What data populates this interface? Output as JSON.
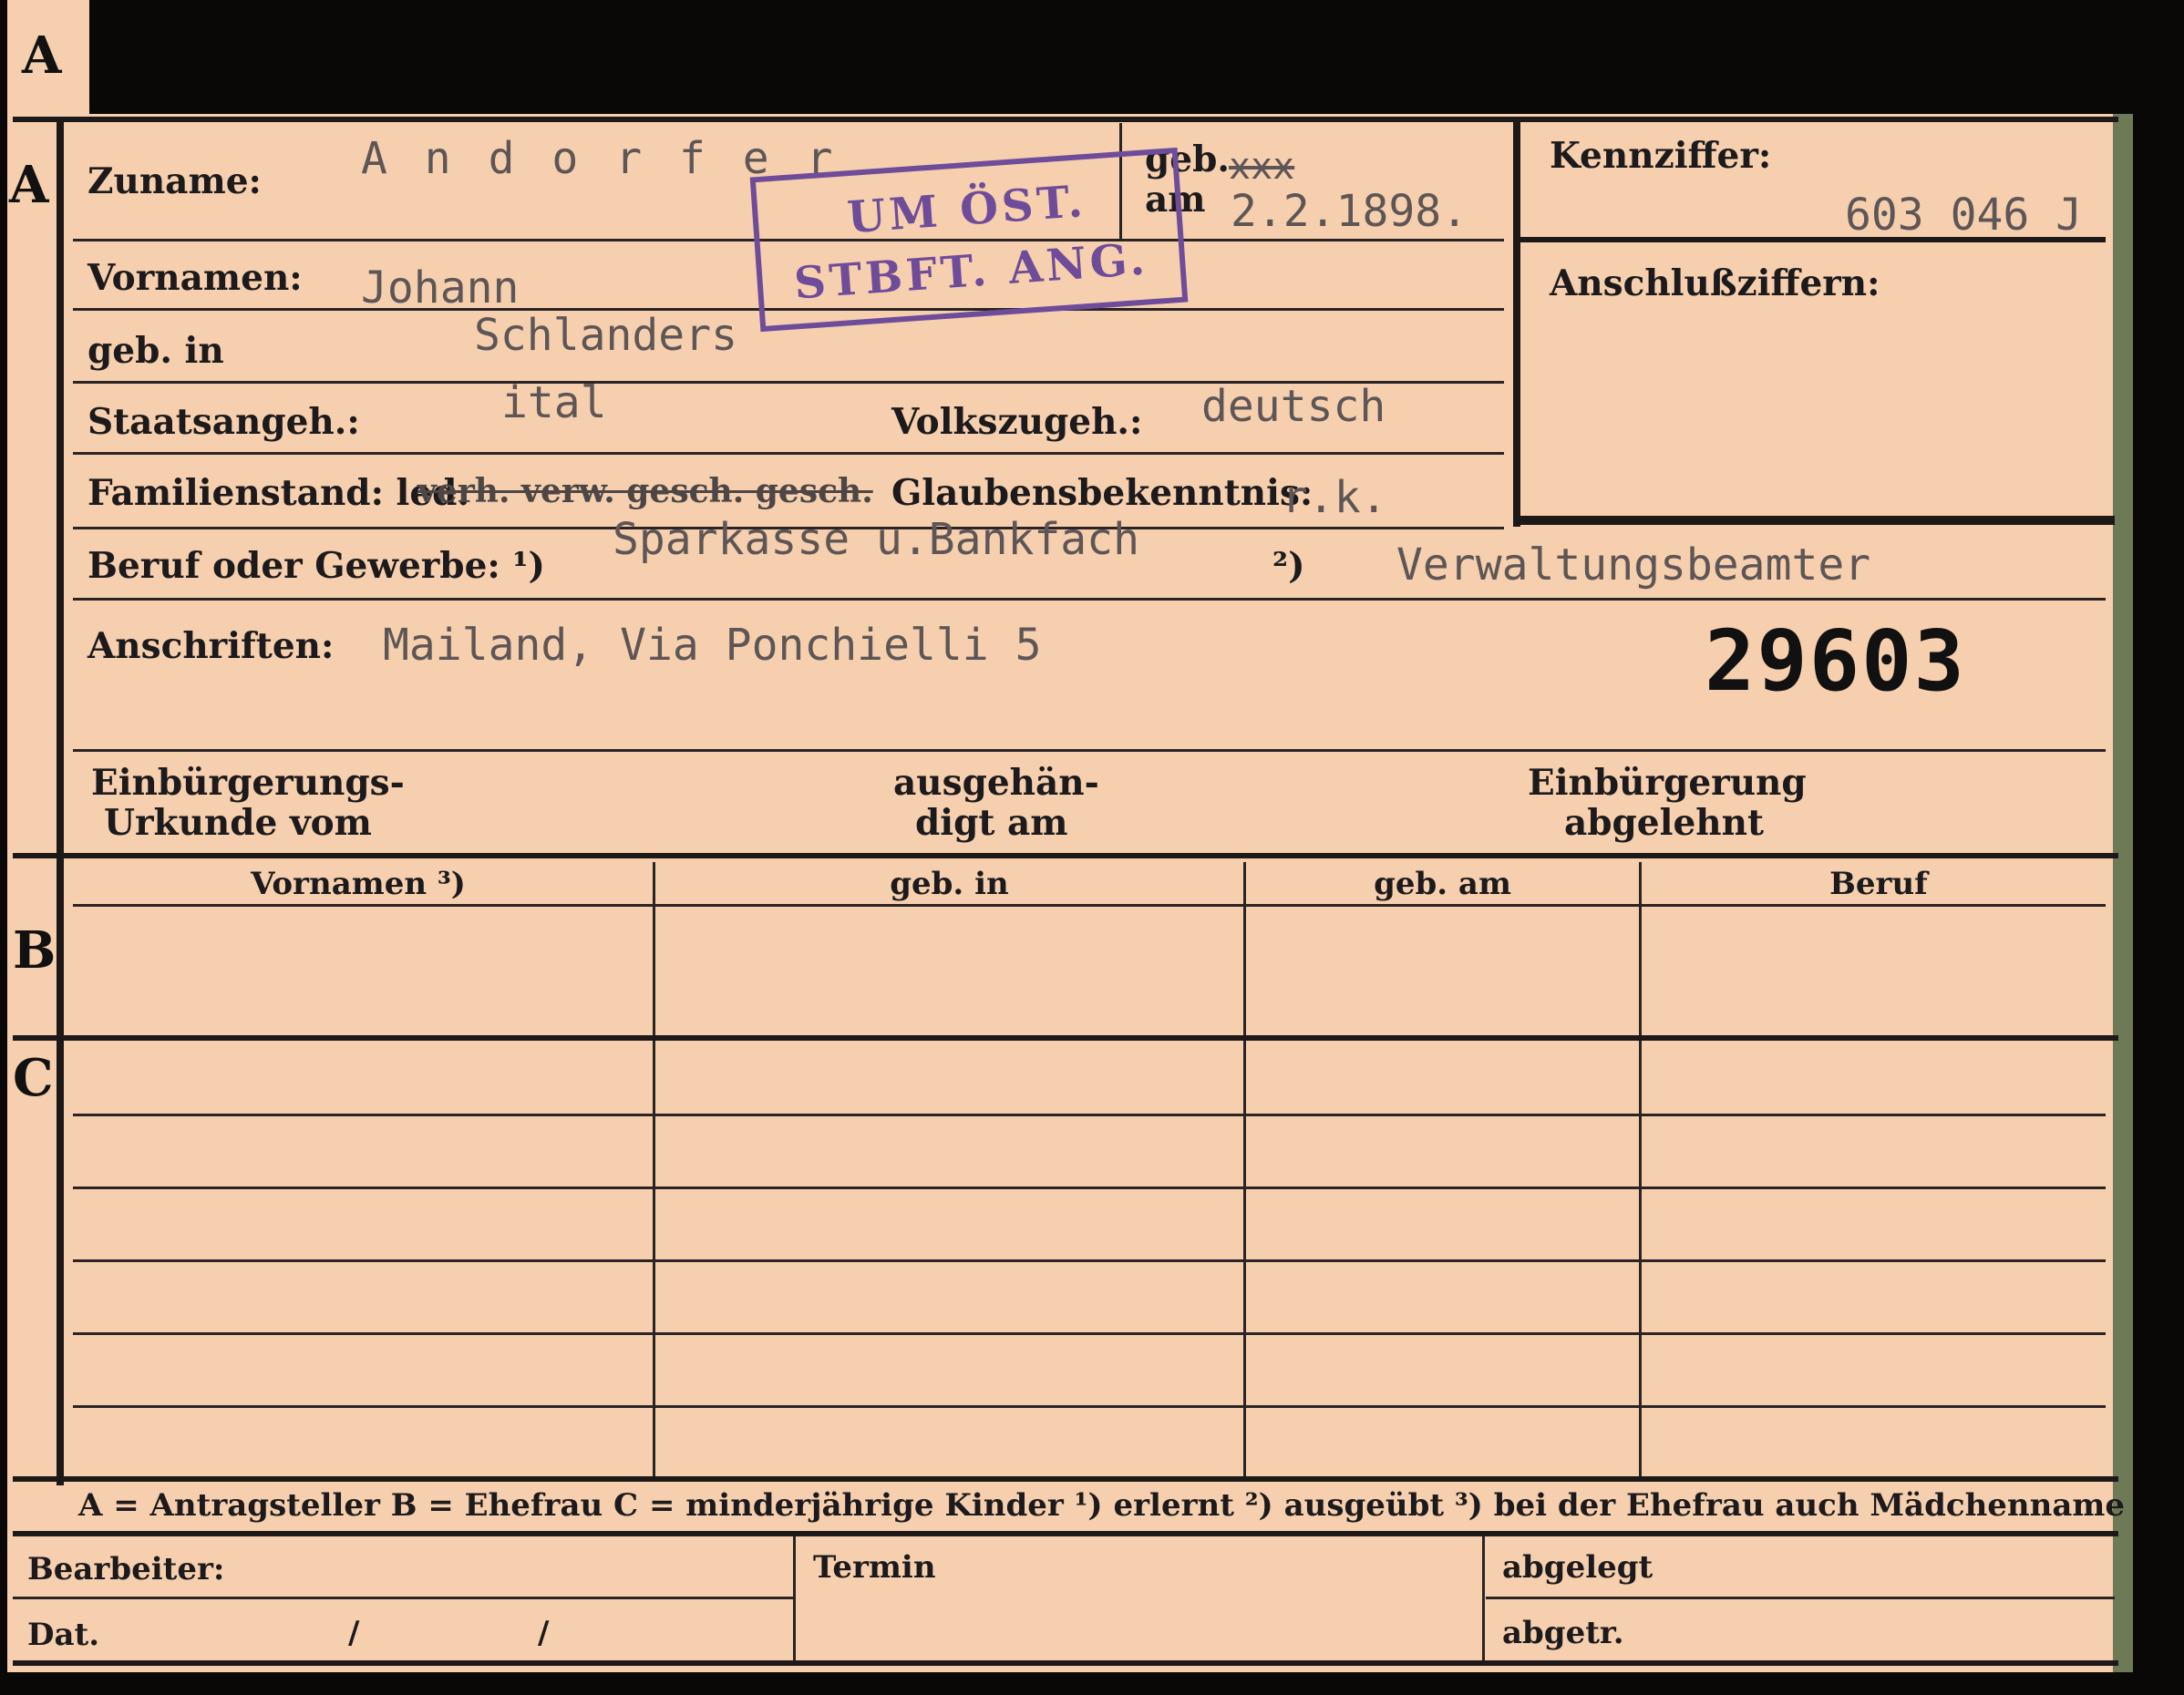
{
  "card": {
    "tab_letter": "A",
    "section_a_letter": "A",
    "section_b_letter": "B",
    "section_c_letter": "C",
    "labels": {
      "zuname": "Zuname:",
      "geb": "geb.",
      "am": "am",
      "kennziffer": "Kennziffer:",
      "anschlussziffern": "Anschlußziffern:",
      "vornamen": "Vornamen:",
      "geb_in": "geb. in",
      "staatsangeh": "Staatsangeh.:",
      "volkszugeh": "Volkszugeh.:",
      "familienstand": "Familienstand: led.",
      "glaubensbekenntnis": "Glaubensbekenntnis:",
      "beruf": "Beruf oder Gewerbe: ¹)",
      "beruf_2": "²)",
      "anschriften": "Anschriften:",
      "einb_urkunde_1": "Einbürgerungs-",
      "einb_urkunde_2": "Urkunde vom",
      "ausgehaendigt_1": "ausgehän-",
      "ausgehaendigt_2": "digt am",
      "einb_abgelehnt_1": "Einbürgerung",
      "einb_abgelehnt_2": "abgelehnt"
    },
    "values": {
      "zuname": "A n d o r f e r",
      "geb_am": "2.2.1898.",
      "geb_am_struck": "xxx",
      "kennziffer": "603 046 J",
      "vornamen": "Johann",
      "geb_in": "Schlanders",
      "staatsangeh": "ital",
      "volkszugeh": "deutsch",
      "familienstand_struck": "verh. verw. gesch. gesch.",
      "glaubensbekenntnis": "r.k.",
      "beruf_erlernt": "Sparkasse u.Bankfach",
      "beruf_ausgeuebt": "Verwaltungsbeamter",
      "anschrift": "Mailand, Via Ponchielli 5",
      "number": "29603"
    },
    "stamp": {
      "line1": "UM ÖST.",
      "line2": "STBFT. ANG.",
      "color": "#6f4c9a"
    },
    "table": {
      "headers": [
        "Vornamen ³)",
        "geb. in",
        "geb. am",
        "Beruf"
      ]
    },
    "legend": "A = Antragsteller   B = Ehefrau   C = minderjährige Kinder   ¹) erlernt   ²) ausgeübt   ³) bei der Ehefrau auch Mädchenname",
    "footer": {
      "bearbeiter": "Bearbeiter:",
      "dat": "Dat.",
      "slash1": "/",
      "slash2": "/",
      "termin": "Termin",
      "abgelegt": "abgelegt",
      "abgetr": "abgetr."
    },
    "colors": {
      "card": "#f6cfae",
      "ink": "#1c1a1c",
      "typewriter": "#5e5656",
      "background": "#0a0806"
    }
  }
}
